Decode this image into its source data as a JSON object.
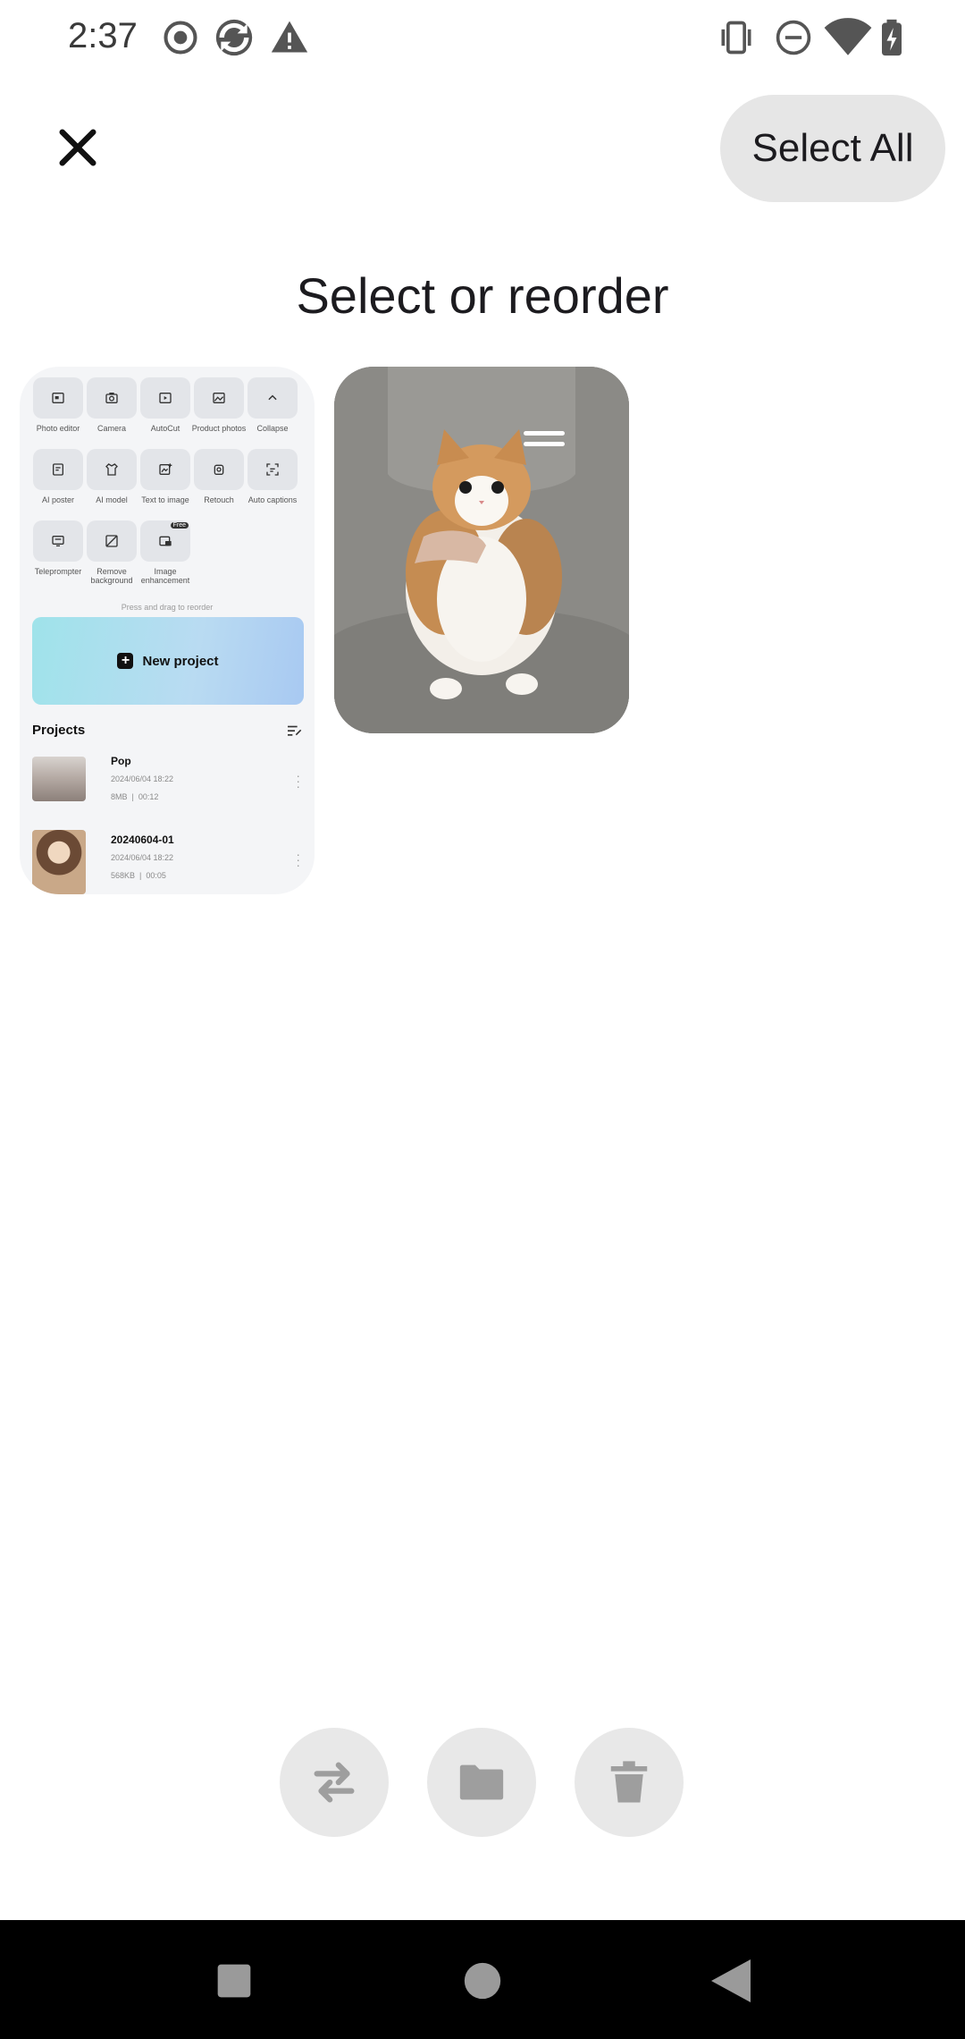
{
  "status_bar": {
    "time": "2:37",
    "left_icons": [
      "record-icon",
      "sync-icon",
      "warning-icon"
    ],
    "right_icons": [
      "vibrate-icon",
      "dnd-icon",
      "wifi-icon",
      "battery-icon"
    ]
  },
  "toolbar": {
    "close_icon": "close-icon",
    "select_all_label": "Select All"
  },
  "page": {
    "title": "Select or reorder"
  },
  "thumbnails": [
    {
      "kind": "app-screenshot",
      "tools": [
        {
          "label": "Photo editor",
          "icon": "photo-editor-icon"
        },
        {
          "label": "Camera",
          "icon": "camera-icon"
        },
        {
          "label": "AutoCut",
          "icon": "autocut-icon"
        },
        {
          "label": "Product photos",
          "icon": "product-photos-icon"
        },
        {
          "label": "Collapse",
          "icon": "chevron-up-icon"
        },
        {
          "label": "AI poster",
          "icon": "ai-poster-icon"
        },
        {
          "label": "AI model",
          "icon": "ai-model-icon"
        },
        {
          "label": "Text to image",
          "icon": "text-to-image-icon"
        },
        {
          "label": "Retouch",
          "icon": "retouch-icon"
        },
        {
          "label": "Auto captions",
          "icon": "auto-captions-icon"
        },
        {
          "label": "Teleprompter",
          "icon": "teleprompter-icon"
        },
        {
          "label": "Remove background",
          "icon": "remove-background-icon"
        },
        {
          "label": "Image enhancement",
          "icon": "image-enhancement-icon",
          "badge": "Free"
        }
      ],
      "hint": "Press and drag to reorder",
      "new_project_label": "New project",
      "projects_title": "Projects",
      "projects": [
        {
          "name": "Pop",
          "date": "2024/06/04 18:22",
          "size": "8MB",
          "duration": "00:12"
        },
        {
          "name": "20240604-01",
          "date": "2024/06/04 18:22",
          "size": "568KB",
          "duration": "00:05"
        }
      ]
    },
    {
      "kind": "photo",
      "subject": "fluffy orange and white kitten held in arms",
      "drag_handle_icon": "drag-handle-icon"
    }
  ],
  "actions": [
    {
      "name": "swap-button",
      "icon": "swap-arrows-icon"
    },
    {
      "name": "move-to-folder-button",
      "icon": "folder-icon"
    },
    {
      "name": "delete-button",
      "icon": "trash-icon"
    }
  ],
  "nav_bar": {
    "icons": [
      "recents-icon",
      "home-icon",
      "back-icon"
    ]
  },
  "colors": {
    "pill_background": "#e6e6e6",
    "action_background": "#e8e8e8",
    "action_icon": "#9e9e9e",
    "nav_background": "#000000"
  }
}
